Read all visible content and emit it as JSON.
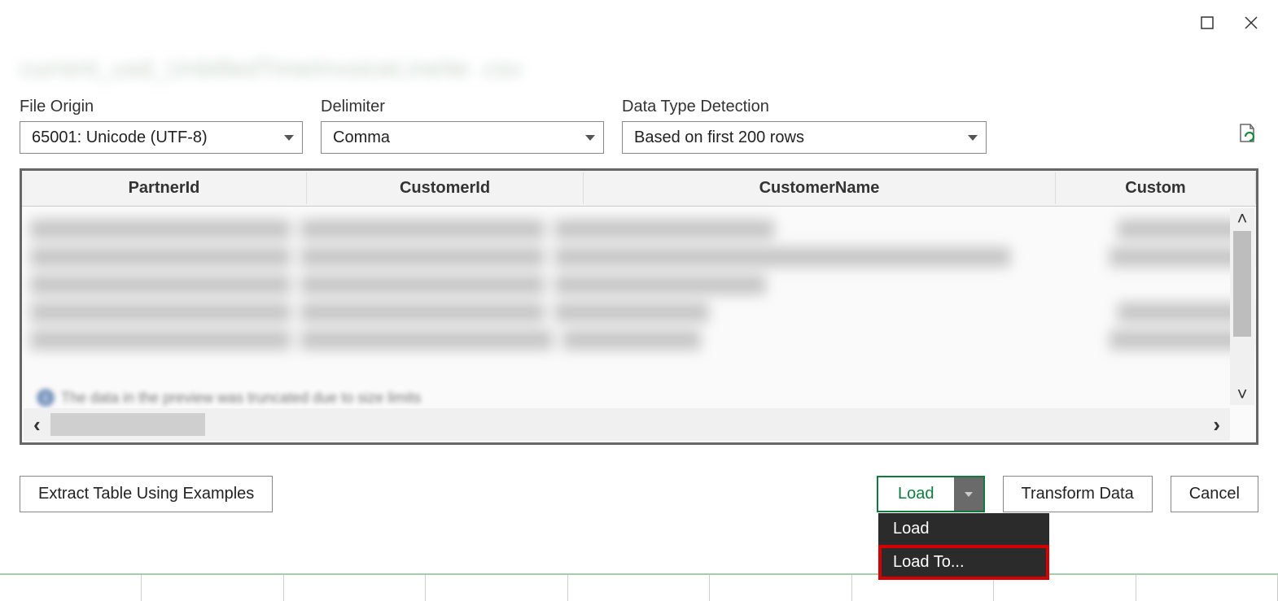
{
  "window": {
    "filename_blur": "current_usd_UnbilledTimeInvoiceLineIte .csv"
  },
  "options": {
    "file_origin_label": "File Origin",
    "file_origin_value": "65001: Unicode (UTF-8)",
    "delimiter_label": "Delimiter",
    "delimiter_value": "Comma",
    "dtd_label": "Data Type Detection",
    "dtd_value": "Based on first 200 rows"
  },
  "columns": {
    "partner": "PartnerId",
    "customer": "CustomerId",
    "customer_name": "CustomerName",
    "custom": "Custom"
  },
  "info_text": "The data in the preview was truncated due to size limits",
  "footer": {
    "extract": "Extract Table Using Examples",
    "load": "Load",
    "transform": "Transform Data",
    "cancel": "Cancel"
  },
  "load_menu": {
    "load": "Load",
    "load_to": "Load To..."
  }
}
